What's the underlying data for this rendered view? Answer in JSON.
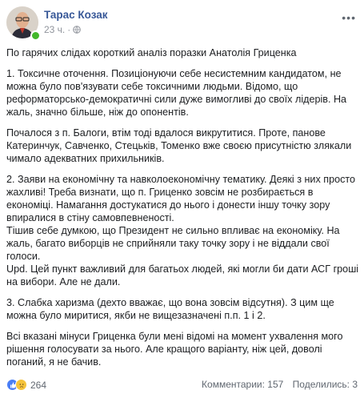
{
  "post": {
    "author": "Тарас Козак",
    "time": "23 ч.",
    "paragraphs": [
      "По гарячих слідах короткий аналіз поразки Анатолія Гриценка",
      "1. Токсичне оточення. Позиціонуючи себе несистемним кандидатом, не можна було пов'язувати себе токсичними людьми. Відомо, що реформаторсько-демократичні сили дуже вимогливі до своїх лідерів. На жаль, значно більше, ніж до опонентів.",
      "Почалося з п. Балоги, втім тоді вдалося викрутитися. Проте, панове Катеринчук, Савченко, Стецьків, Томенко вже своєю присутністю злякали чимало адекватних прихильників.",
      "2. Заяви на економічну та навколоекономічну тематику. Деякі з них просто жахливі! Треба визнати, що п. Гриценко зовсім не розбирається в економіці. Намагання достукатися до нього і донести іншу точку зору впиралися в стіну самовпевненості.\nТішив себе думкою, що Президент не сильно впливає на економіку. На жаль, багато виборців не сприйняли таку точку зору і не віддали свої голоси.\nUpd. Цей пункт важливий для багатьох людей, які могли би дати АСГ гроші на вибори. Але не дали.",
      "3. Слабка харизма (дехто вважає, що вона зовсім відсутня). З цим ще можна було миритися, якби не вищезазначені п.п. 1 і 2.",
      "Всі вказані мінуси Гриценка були мені відомі на момент ухвалення мого рішення голосувати за нього. Але кращого варіанту, ніж цей, доволі поганий, я не бачив."
    ]
  },
  "footer": {
    "reactions_count": "264",
    "comments": "Комментарии: 157",
    "shares": "Поделились: 3"
  },
  "colors": {
    "author_link": "#385898",
    "like_blue": "#4a7ef5",
    "online_green": "#42b72a"
  }
}
